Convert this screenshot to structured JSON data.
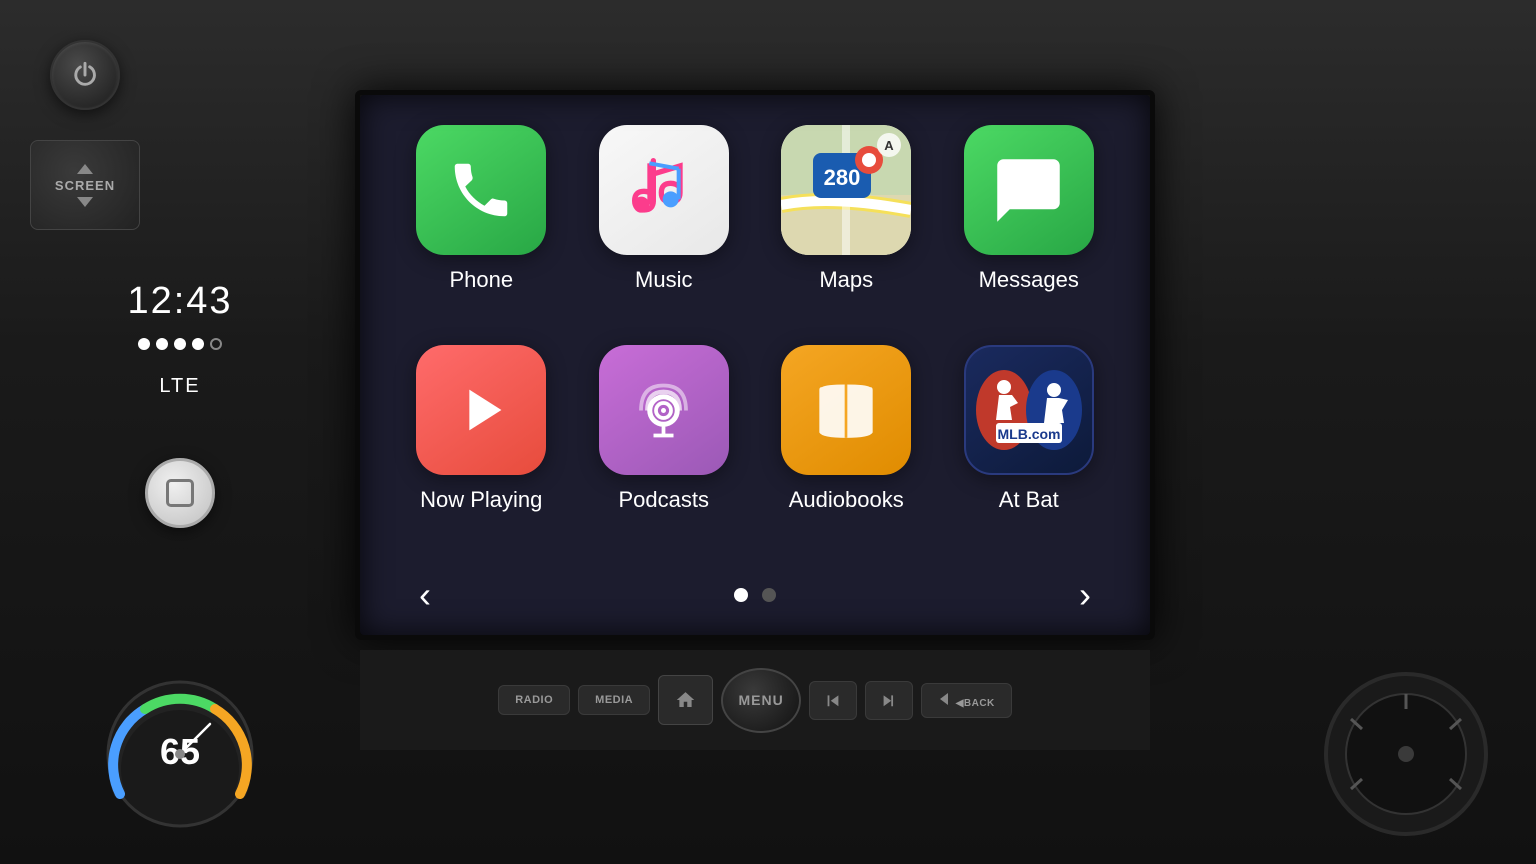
{
  "screen": {
    "time": "12:43",
    "network": "LTE",
    "signal_dots": 4,
    "total_dots": 5
  },
  "apps": [
    {
      "id": "phone",
      "label": "Phone",
      "icon_type": "phone",
      "bg_color": "#4cd964"
    },
    {
      "id": "music",
      "label": "Music",
      "icon_type": "music",
      "bg_color": "#f8f8f8"
    },
    {
      "id": "maps",
      "label": "Maps",
      "icon_type": "maps",
      "bg_color": "#e8e0c0"
    },
    {
      "id": "messages",
      "label": "Messages",
      "icon_type": "messages",
      "bg_color": "#4cd964"
    },
    {
      "id": "nowplaying",
      "label": "Now Playing",
      "icon_type": "nowplaying",
      "bg_color": "#e74c3c"
    },
    {
      "id": "podcasts",
      "label": "Podcasts",
      "icon_type": "podcasts",
      "bg_color": "#9b59b6"
    },
    {
      "id": "audiobooks",
      "label": "Audiobooks",
      "icon_type": "audiobooks",
      "bg_color": "#f5a623"
    },
    {
      "id": "atbat",
      "label": "At Bat",
      "icon_type": "atbat",
      "bg_color": "#1a2a5e"
    }
  ],
  "navigation": {
    "current_page": 1,
    "total_pages": 2,
    "back_arrow": "‹",
    "forward_arrow": "›"
  },
  "physical_buttons": [
    {
      "label": "RADIO",
      "type": "text"
    },
    {
      "label": "MEDIA",
      "type": "text"
    },
    {
      "label": "⌂",
      "type": "home"
    },
    {
      "label": "MENU",
      "type": "menu"
    },
    {
      "label": "|◀◀",
      "type": "prev"
    },
    {
      "label": "▶▶|",
      "type": "next"
    },
    {
      "label": "◀BACK",
      "type": "back"
    }
  ],
  "speed": "65",
  "power_icon": "⏻",
  "screen_label": "SCREEN"
}
